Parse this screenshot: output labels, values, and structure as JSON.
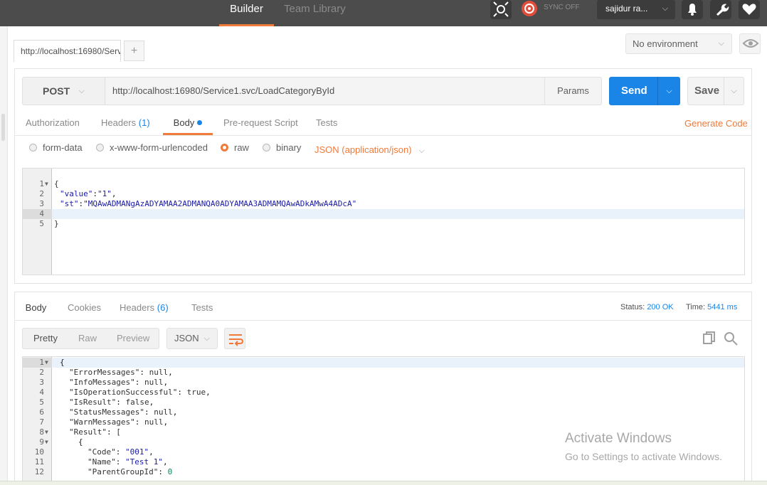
{
  "topbar": {
    "tabs": [
      "Builder",
      "Team Library"
    ],
    "sync_label": "SYNC OFF",
    "user": "sajidur ra...",
    "icons": [
      "interceptor-icon",
      "sync-icon",
      "bell-icon",
      "wrench-icon",
      "heart-icon"
    ]
  },
  "request_tab": {
    "label": "http://localhost:16980/Servi",
    "add_label": "+"
  },
  "environment": {
    "selected": "No environment"
  },
  "request": {
    "method": "POST",
    "url": "http://localhost:16980/Service1.svc/LoadCategoryById",
    "params_label": "Params",
    "send_label": "Send",
    "save_label": "Save"
  },
  "request_tabs": [
    {
      "label": "Authorization"
    },
    {
      "label": "Headers",
      "count": "(1)"
    },
    {
      "label": "Body"
    },
    {
      "label": "Pre-request Script"
    },
    {
      "label": "Tests"
    }
  ],
  "generate_code_label": "Generate Code",
  "body_modes": [
    "form-data",
    "x-www-form-urlencoded",
    "raw",
    "binary"
  ],
  "body_mode_selected": "raw",
  "content_type": "JSON (application/json)",
  "request_body_lines": [
    {
      "n": "1",
      "text": "{"
    },
    {
      "n": "2",
      "key": "\"value\"",
      "sep": ":",
      "val": "\"1\"",
      "end": ","
    },
    {
      "n": "3",
      "key": "\"st\"",
      "sep": ":",
      "val": "\"MQAwADMANgAzADYAMAA2ADMANQA0ADYAMAA3ADMAMQAwADkAMwA4ADcA\"",
      "end": ""
    },
    {
      "n": "4",
      "text": ""
    },
    {
      "n": "5",
      "text": "}"
    }
  ],
  "response_tabs": [
    {
      "label": "Body"
    },
    {
      "label": "Cookies"
    },
    {
      "label": "Headers",
      "count": "(6)"
    },
    {
      "label": "Tests"
    }
  ],
  "status": {
    "label": "Status:",
    "value": "200 OK"
  },
  "time": {
    "label": "Time:",
    "value": "5441 ms"
  },
  "view_modes": [
    "Pretty",
    "Raw",
    "Preview"
  ],
  "response_format": "JSON",
  "response_lines": [
    {
      "n": "1",
      "fold": true,
      "indent": 0,
      "text": "{"
    },
    {
      "n": "2",
      "indent": 1,
      "key": "\"ErrorMessages\"",
      "val": "null",
      "end": ","
    },
    {
      "n": "3",
      "indent": 1,
      "key": "\"InfoMessages\"",
      "val": "null",
      "end": ","
    },
    {
      "n": "4",
      "indent": 1,
      "key": "\"IsOperationSuccessful\"",
      "val": "true",
      "end": ","
    },
    {
      "n": "5",
      "indent": 1,
      "key": "\"IsResult\"",
      "val": "false",
      "end": ","
    },
    {
      "n": "6",
      "indent": 1,
      "key": "\"StatusMessages\"",
      "val": "null",
      "end": ","
    },
    {
      "n": "7",
      "indent": 1,
      "key": "\"WarnMessages\"",
      "val": "null",
      "end": ","
    },
    {
      "n": "8",
      "fold": true,
      "indent": 1,
      "key": "\"Result\"",
      "val": "[",
      "end": ""
    },
    {
      "n": "9",
      "fold": true,
      "indent": 2,
      "text": "{"
    },
    {
      "n": "10",
      "indent": 3,
      "key": "\"Code\"",
      "val": "\"001\"",
      "end": ","
    },
    {
      "n": "11",
      "indent": 3,
      "key": "\"Name\"",
      "val": "\"Test 1\"",
      "end": ","
    },
    {
      "n": "12",
      "indent": 3,
      "key": "\"ParentGroupId\"",
      "val": "0",
      "end": ""
    }
  ],
  "watermark": {
    "line1": "Activate Windows",
    "line2": "Go to Settings to activate Windows."
  },
  "colors": {
    "accent": "#f07a3a",
    "primary": "#1a85e6",
    "topbar": "#4c4c4c"
  }
}
